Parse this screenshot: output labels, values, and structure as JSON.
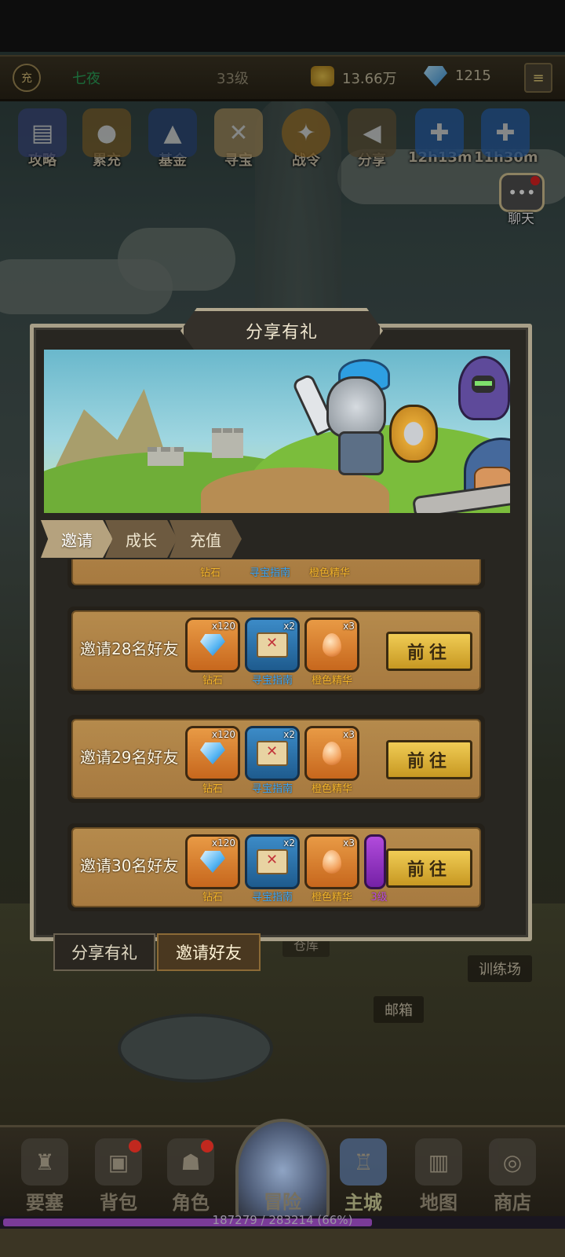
{
  "player": {
    "badge": "充",
    "name": "七夜",
    "level": "33级",
    "gold": "13.66万",
    "gems": "1215"
  },
  "top_icons": [
    {
      "label": "攻略"
    },
    {
      "label": "累充"
    },
    {
      "label": "基金"
    },
    {
      "label": "寻宝"
    },
    {
      "label": "战令"
    },
    {
      "label": "分享"
    },
    {
      "label": "12h13m"
    },
    {
      "label": "11h30m"
    }
  ],
  "chat": {
    "label": "聊天"
  },
  "modal": {
    "title": "分享有礼",
    "tabs": [
      {
        "label": "邀请"
      },
      {
        "label": "成长"
      },
      {
        "label": "充值"
      }
    ],
    "active_tab": "邀请",
    "partial_row": {
      "rewards": [
        "钻石",
        "寻宝指南",
        "橙色精华"
      ]
    },
    "rows": [
      {
        "label": "邀请28名好友",
        "rewards": [
          {
            "name": "钻石",
            "qty": "x120"
          },
          {
            "name": "寻宝指南",
            "qty": "x2"
          },
          {
            "name": "橙色精华",
            "qty": "x3"
          }
        ],
        "button": "前往"
      },
      {
        "label": "邀请29名好友",
        "rewards": [
          {
            "name": "钻石",
            "qty": "x120"
          },
          {
            "name": "寻宝指南",
            "qty": "x2"
          },
          {
            "name": "橙色精华",
            "qty": "x3"
          }
        ],
        "button": "前往"
      },
      {
        "label": "邀请30名好友",
        "rewards": [
          {
            "name": "钻石",
            "qty": "x120"
          },
          {
            "name": "寻宝指南",
            "qty": "x2"
          },
          {
            "name": "橙色精华",
            "qty": "x3"
          },
          {
            "name": "3级",
            "qty": ""
          }
        ],
        "button": "前往"
      }
    ]
  },
  "sub_tabs": [
    {
      "label": "分享有礼"
    },
    {
      "label": "邀请好友"
    }
  ],
  "background_labels": {
    "warehouse": "仓库",
    "training": "训练场",
    "mailbox": "邮箱"
  },
  "bottom_nav": [
    {
      "label": "要塞"
    },
    {
      "label": "背包"
    },
    {
      "label": "角色"
    },
    {
      "label": "冒险"
    },
    {
      "label": "主城"
    },
    {
      "label": "地图"
    },
    {
      "label": "商店"
    }
  ],
  "xp": {
    "text": "187279 / 283214 (66%)",
    "fraction": 0.66
  },
  "colors": {
    "accent_gold": "#f0cc55",
    "modal_border": "#a89f88",
    "reward_name_orange": "#f2b42c",
    "reward_name_blue": "#37a7ff"
  }
}
